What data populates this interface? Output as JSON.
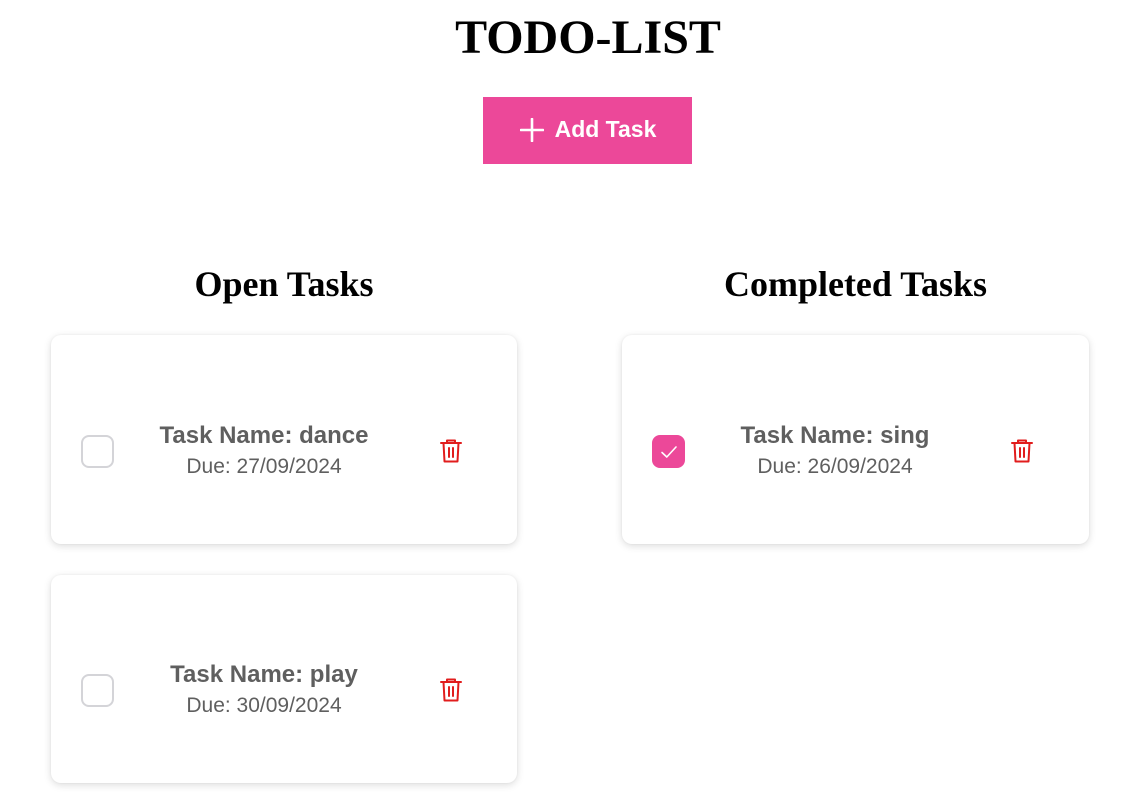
{
  "page": {
    "title": "TODO-LIST"
  },
  "toolbar": {
    "add_label": "Add Task",
    "add_icon": "plus-icon",
    "accent_color": "#ec4899"
  },
  "columns": {
    "open": {
      "heading": "Open Tasks",
      "tasks": [
        {
          "name": "Task Name: dance",
          "due": "Due: 27/09/2024",
          "completed": false
        },
        {
          "name": "Task Name: play",
          "due": "Due: 30/09/2024",
          "completed": false
        }
      ]
    },
    "completed": {
      "heading": "Completed Tasks",
      "tasks": [
        {
          "name": "Task Name: sing",
          "due": "Due: 26/09/2024",
          "completed": true
        }
      ]
    }
  },
  "icons": {
    "delete": "trash-icon",
    "check": "checkmark-icon"
  },
  "colors": {
    "delete_icon": "#e11d1d",
    "text_muted": "#5f5f5f",
    "checkbox_border": "#d4d4d8"
  }
}
